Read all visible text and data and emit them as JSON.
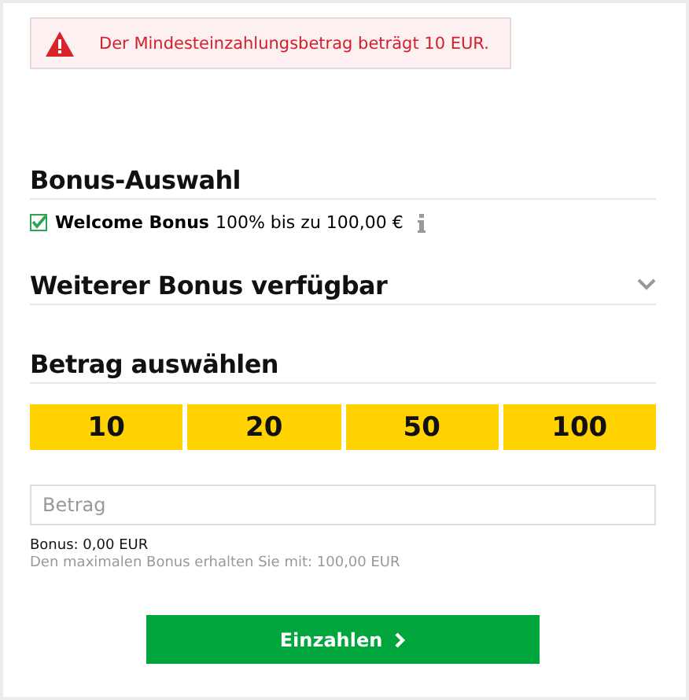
{
  "alert": {
    "message": "Der Mindesteinzahlungsbetrag beträgt 10 EUR."
  },
  "bonus_selection": {
    "heading": "Bonus-Auswahl",
    "bonuses": [
      {
        "name": "Welcome Bonus",
        "description": "100% bis zu 100,00 €",
        "checked": true
      }
    ]
  },
  "more_bonus": {
    "heading": "Weiterer Bonus verfügbar",
    "expanded": false
  },
  "amount": {
    "heading": "Betrag auswählen",
    "presets": [
      {
        "label": "10",
        "selected": false
      },
      {
        "label": "20",
        "selected": false
      },
      {
        "label": "50",
        "selected": false
      },
      {
        "label": "100",
        "selected": false
      }
    ],
    "input": {
      "placeholder": "Betrag"
    },
    "bonus_info": "Bonus: 0,00 EUR",
    "max_bonus_hint": "Den maximalen Bonus erhalten Sie mit: 100,00 EUR"
  },
  "submit_button": {
    "label": "Einzahlen"
  }
}
